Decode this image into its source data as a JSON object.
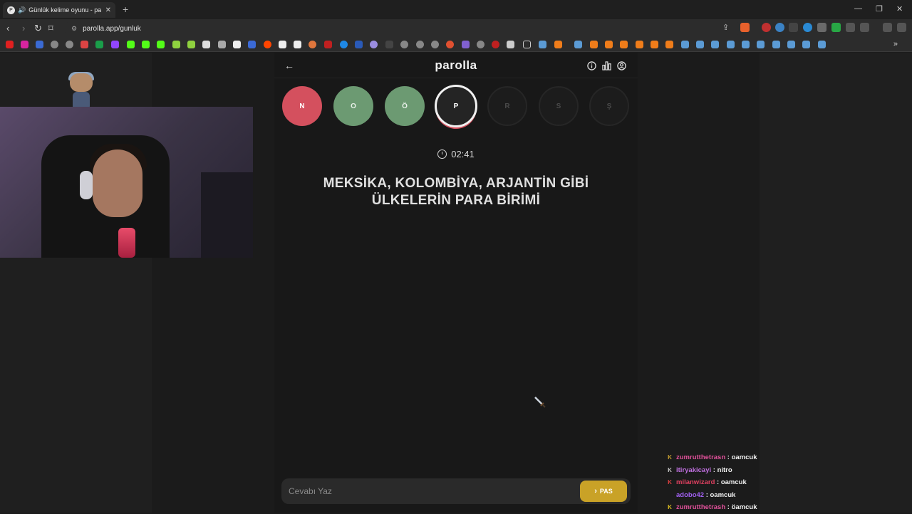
{
  "browser": {
    "tab_title": "Günlük kelime oyunu - paroll",
    "url": "parolla.app/gunluk"
  },
  "app": {
    "logo": "parolla",
    "letters": [
      {
        "char": "N",
        "state": "red"
      },
      {
        "char": "O",
        "state": "green"
      },
      {
        "char": "Ö",
        "state": "green"
      },
      {
        "char": "P",
        "state": "active"
      },
      {
        "char": "R",
        "state": "pending"
      },
      {
        "char": "S",
        "state": "pending"
      },
      {
        "char": "Ş",
        "state": "pending"
      }
    ],
    "timer": "02:41",
    "question_line1": "MEKSİKA, KOLOMBİYA, ARJANTİN GİBİ",
    "question_line2": "ÜLKELERİN PARA BİRİMİ",
    "answer_placeholder": "Cevabı Yaz",
    "pass_label": "PAS"
  },
  "chat": [
    {
      "user": "zumrutthetrasn",
      "user_color": "#e0509a",
      "badge": "K",
      "badge_color": "#c8a030",
      "message": ": oamcuk"
    },
    {
      "user": "itiryakicayi",
      "user_color": "#c070e0",
      "badge": "K",
      "badge_color": "#cccccc",
      "message": ": nitro"
    },
    {
      "user": "milanwizard",
      "user_color": "#e04060",
      "badge": "K",
      "badge_color": "#e04040",
      "message": ": oamcuk"
    },
    {
      "user": "adobo42",
      "user_color": "#a060f0",
      "badge": "",
      "badge_color": "#000000",
      "message": ": oamcuk"
    },
    {
      "user": "zumrutthetrash",
      "user_color": "#e0509a",
      "badge": "K",
      "badge_color": "#e0c020",
      "message": ": öamcuk"
    }
  ]
}
